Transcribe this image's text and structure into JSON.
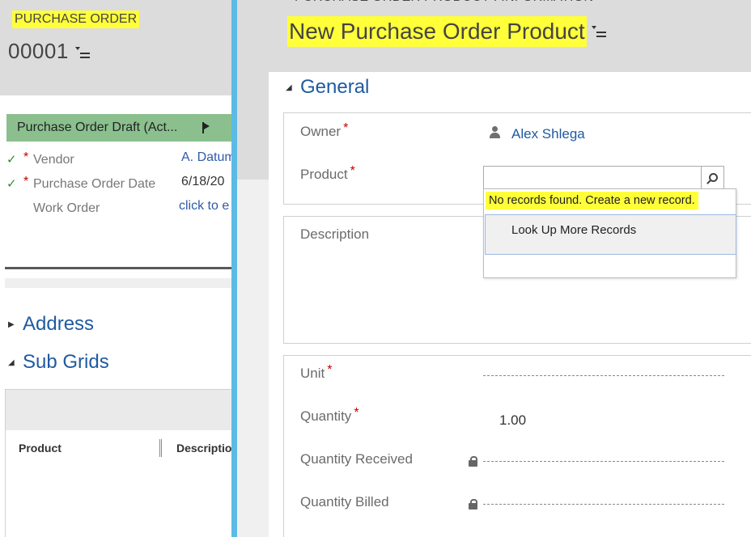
{
  "left_form": {
    "entity_label": "PURCHASE ORDER",
    "record_number": "00001",
    "process": {
      "stage_label": "Purchase Order Draft (Act...",
      "steps": [
        {
          "label": "Vendor",
          "required": "*",
          "check": "✓",
          "value": "A. Datum"
        },
        {
          "label": "Purchase Order Date",
          "required": "*",
          "check": "✓",
          "value": "6/18/20"
        },
        {
          "label": "Work Order",
          "required": "",
          "check": "",
          "value": "click to e"
        }
      ]
    },
    "sections": {
      "address": "Address",
      "sub_grids": "Sub Grids"
    },
    "subgrid_columns": [
      "Product",
      "Descriptio"
    ]
  },
  "dialog": {
    "breadcrumb": "PURCHASE ORDER PRODUCT : INFORMATION",
    "title": "New Purchase Order Product",
    "section_general": "General",
    "owner": {
      "label": "Owner",
      "required": "*",
      "value": "Alex Shlega"
    },
    "product": {
      "label": "Product",
      "required": "*",
      "value": ""
    },
    "lookup_dropdown": {
      "message": "No records found. Create a new record.",
      "item": "Look Up More Records"
    },
    "description_label": "Description",
    "unit": {
      "label": "Unit",
      "required": "*"
    },
    "quantity": {
      "label": "Quantity",
      "required": "*",
      "value": "1.00"
    },
    "quantity_received": {
      "label": "Quantity Received"
    },
    "quantity_billed": {
      "label": "Quantity Billed"
    }
  },
  "colors": {
    "highlight": "#ffff3a",
    "link_blue": "#1f5aa0",
    "process_green": "#8bc08e",
    "divider_blue": "#5cbbe5",
    "required_red": "#c00000"
  },
  "icons": [
    "menu-icon",
    "flag-icon",
    "check-icon",
    "collapse-triangle-icon",
    "user-icon",
    "search-icon",
    "lock-icon"
  ]
}
